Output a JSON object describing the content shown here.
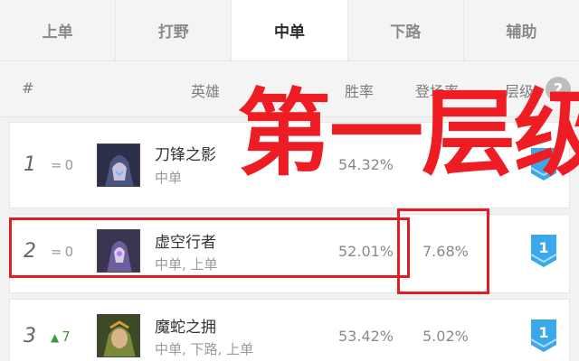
{
  "tabs": [
    {
      "label": "上单",
      "active": false
    },
    {
      "label": "打野",
      "active": false
    },
    {
      "label": "中单",
      "active": true
    },
    {
      "label": "下路",
      "active": false
    },
    {
      "label": "辅助",
      "active": false
    }
  ],
  "header": {
    "rank": "#",
    "hero": "英雄",
    "win_rate": "胜率",
    "pick_rate": "登场率",
    "tier": "层级",
    "help_icon": "?"
  },
  "rows": [
    {
      "rank": "1",
      "trend_symbol": "=",
      "trend_value": "0",
      "trend_type": "same",
      "name": "刀锋之影",
      "positions": "中单",
      "win_rate": "54.32%",
      "pick_rate": "",
      "tier": "",
      "portrait_icon": "hero-portrait-talon"
    },
    {
      "rank": "2",
      "trend_symbol": "=",
      "trend_value": "0",
      "trend_type": "same",
      "name": "虚空行者",
      "positions": "中单, 上单",
      "win_rate": "52.01%",
      "pick_rate": "7.68%",
      "tier": "1",
      "portrait_icon": "hero-portrait-kassadin"
    },
    {
      "rank": "3",
      "trend_symbol": "▲",
      "trend_value": "7",
      "trend_type": "up",
      "name": "魔蛇之拥",
      "positions": "中单, 下路, 上单",
      "win_rate": "53.42%",
      "pick_rate": "5.02%",
      "tier": "1",
      "portrait_icon": "hero-portrait-cassiopeia"
    }
  ],
  "overlay": {
    "title": "第一层级"
  },
  "colors": {
    "annotation_red": "#e51c23",
    "tier_badge_blue": "#3aa8ea",
    "trend_up_green": "#3a9a3a"
  }
}
